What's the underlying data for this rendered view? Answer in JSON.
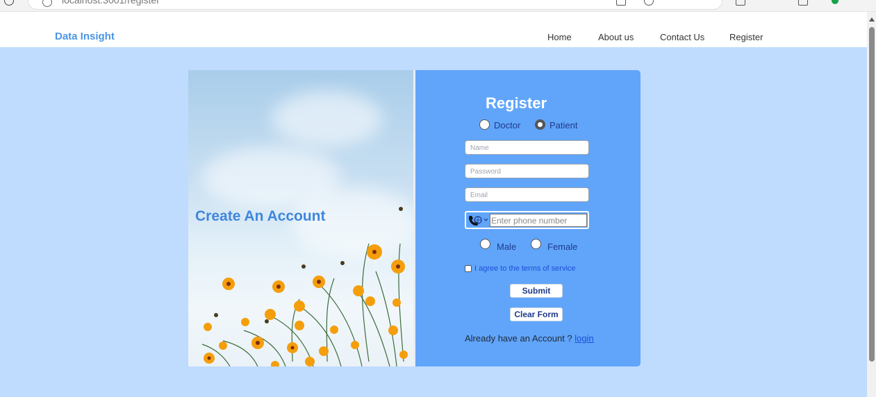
{
  "browser": {
    "url_host": "localhost",
    "url_rest": ":3001/register"
  },
  "navbar": {
    "brand": "Data Insight",
    "links": [
      "Home",
      "About us",
      "Contact Us",
      "Register"
    ]
  },
  "hero": {
    "headline": "Create An Account"
  },
  "form": {
    "title": "Register",
    "role_options": [
      {
        "label": "Doctor",
        "checked": false
      },
      {
        "label": "Patient",
        "checked": true
      }
    ],
    "name_placeholder": "Name",
    "password_placeholder": "Password",
    "email_placeholder": "Email",
    "phone_placeholder": "Enter phone number",
    "gender_options": [
      {
        "label": "Male",
        "checked": false
      },
      {
        "label": "Female",
        "checked": false
      }
    ],
    "terms_label": "I agree to the terms of service",
    "terms_checked": false,
    "submit_label": "Submit",
    "clear_label": "Clear Form",
    "account_prompt": "Already have an Account ?",
    "login_label": "login"
  },
  "colors": {
    "page_bg": "#bfdbfe",
    "form_bg": "#60a5fa",
    "brand": "#4b95e6",
    "headline": "#3f86dc"
  }
}
